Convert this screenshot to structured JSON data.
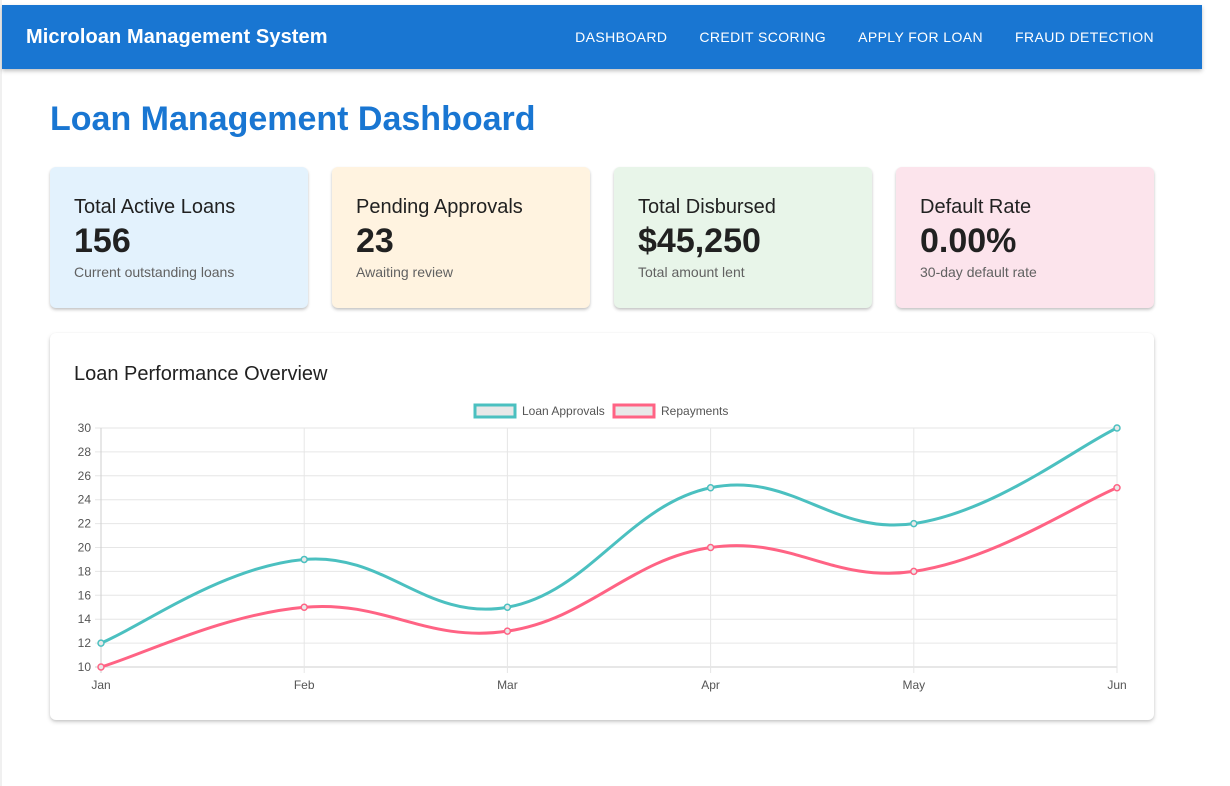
{
  "app": {
    "title": "Microloan Management System",
    "nav": [
      "DASHBOARD",
      "CREDIT SCORING",
      "APPLY FOR LOAN",
      "FRAUD DETECTION"
    ]
  },
  "colors": {
    "primary": "#1976d2",
    "card_backgrounds": [
      "#e3f2fd",
      "#fff3e0",
      "#e8f5e9",
      "#fce4ec"
    ],
    "approvals_line": "#4bc0c0",
    "repayments_line": "#ff6384"
  },
  "page": {
    "title": "Loan Management Dashboard"
  },
  "stats": [
    {
      "title": "Total Active Loans",
      "value": "156",
      "subtitle": "Current outstanding loans"
    },
    {
      "title": "Pending Approvals",
      "value": "23",
      "subtitle": "Awaiting review"
    },
    {
      "title": "Total Disbursed",
      "value": "$45,250",
      "subtitle": "Total amount lent"
    },
    {
      "title": "Default Rate",
      "value": "0.00%",
      "subtitle": "30-day default rate"
    }
  ],
  "chart": {
    "title": "Loan Performance Overview"
  },
  "chart_data": {
    "type": "line",
    "categories": [
      "Jan",
      "Feb",
      "Mar",
      "Apr",
      "May",
      "Jun"
    ],
    "series": [
      {
        "name": "Loan Approvals",
        "values": [
          12,
          19,
          15,
          25,
          22,
          30
        ],
        "color": "#4bc0c0"
      },
      {
        "name": "Repayments",
        "values": [
          10,
          15,
          13,
          20,
          18,
          25
        ],
        "color": "#ff6384"
      }
    ],
    "ylim": [
      10,
      30
    ],
    "yticks": [
      10,
      12,
      14,
      16,
      18,
      20,
      22,
      24,
      26,
      28,
      30
    ],
    "grid": true,
    "legend": "top-center"
  }
}
